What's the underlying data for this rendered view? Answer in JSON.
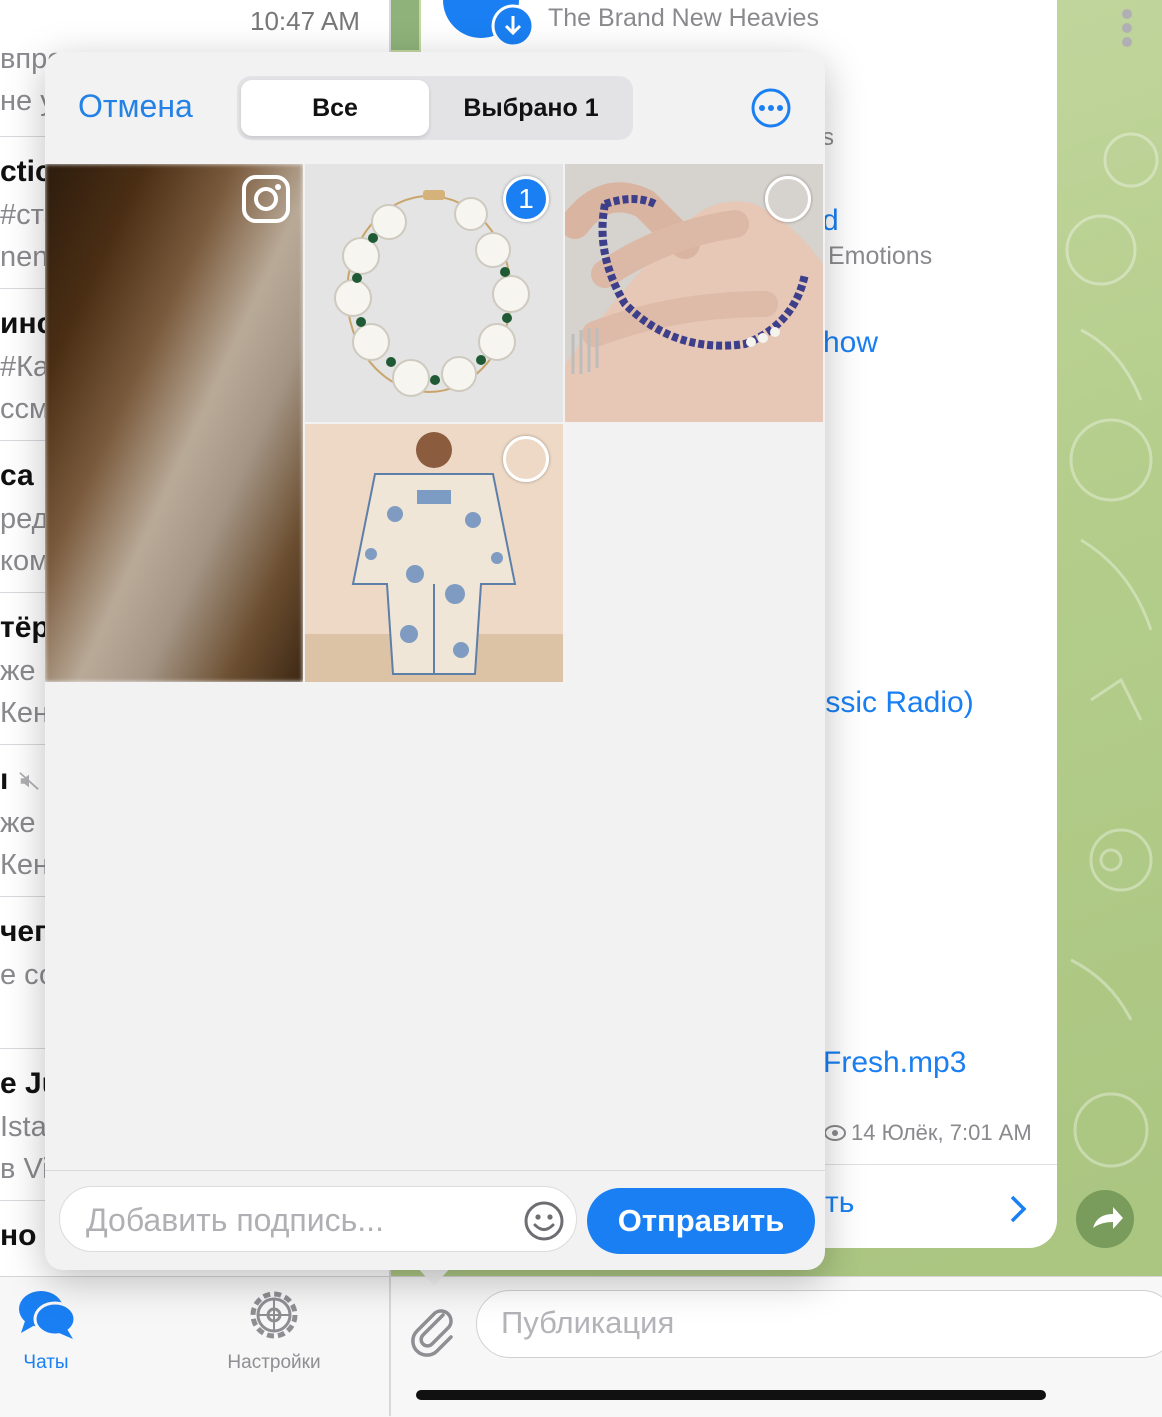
{
  "status_time": "10:47 AM",
  "chat_list": [
    {
      "title": "",
      "line1": "впро",
      "line2": "не у"
    },
    {
      "title": "ctic",
      "line1": "#ста",
      "line2": "nent"
    },
    {
      "title": "инс",
      "line1": "#Ка",
      "line2": "ссм"
    },
    {
      "title": "са",
      "line1": "ред",
      "line2": "ком"
    },
    {
      "title": "тёр",
      "line1": "же",
      "line2": "Кен"
    },
    {
      "title": "ı",
      "line1": "же",
      "line2": "Кен",
      "muted": true
    },
    {
      "title": "чег",
      "line1": "е со",
      "line2": ""
    },
    {
      "title": "e Ju",
      "line1": "Ista",
      "line2": "в Vi"
    },
    {
      "title": "но |",
      "line1": "",
      "line2": ""
    }
  ],
  "tabbar": {
    "chats_label": "Чаты",
    "settings_label": "Настройки"
  },
  "chat_peek": {
    "audio_title": "The Brand New Heavies",
    "s": "s",
    "d": "d",
    "emotions": "Emotions",
    "how": "how",
    "radio": "ıssic Radio)",
    "fresh": "Fresh.mp3",
    "views_date": "14 Юлёк, 7:01 AM",
    "link_fragment": "ть"
  },
  "composer": {
    "placeholder": "Публикация"
  },
  "picker": {
    "cancel_label": "Отмена",
    "segment_all": "Все",
    "segment_selected": "Выбрано 1",
    "caption_placeholder": "Добавить подпись...",
    "send_label": "Отправить",
    "photos": [
      {
        "name": "blurred-brown-photo",
        "badge": "instagram-icon"
      },
      {
        "name": "pearl-bracelet-photo",
        "selected": true,
        "order": "1"
      },
      {
        "name": "blue-bead-bracelet-photo",
        "selected": false
      },
      {
        "name": "floral-kimono-outfit-photo",
        "selected": false
      }
    ]
  },
  "colors": {
    "accent": "#1a7ff2",
    "link": "#2481e6",
    "chat_bg": "#b4cd8b"
  }
}
